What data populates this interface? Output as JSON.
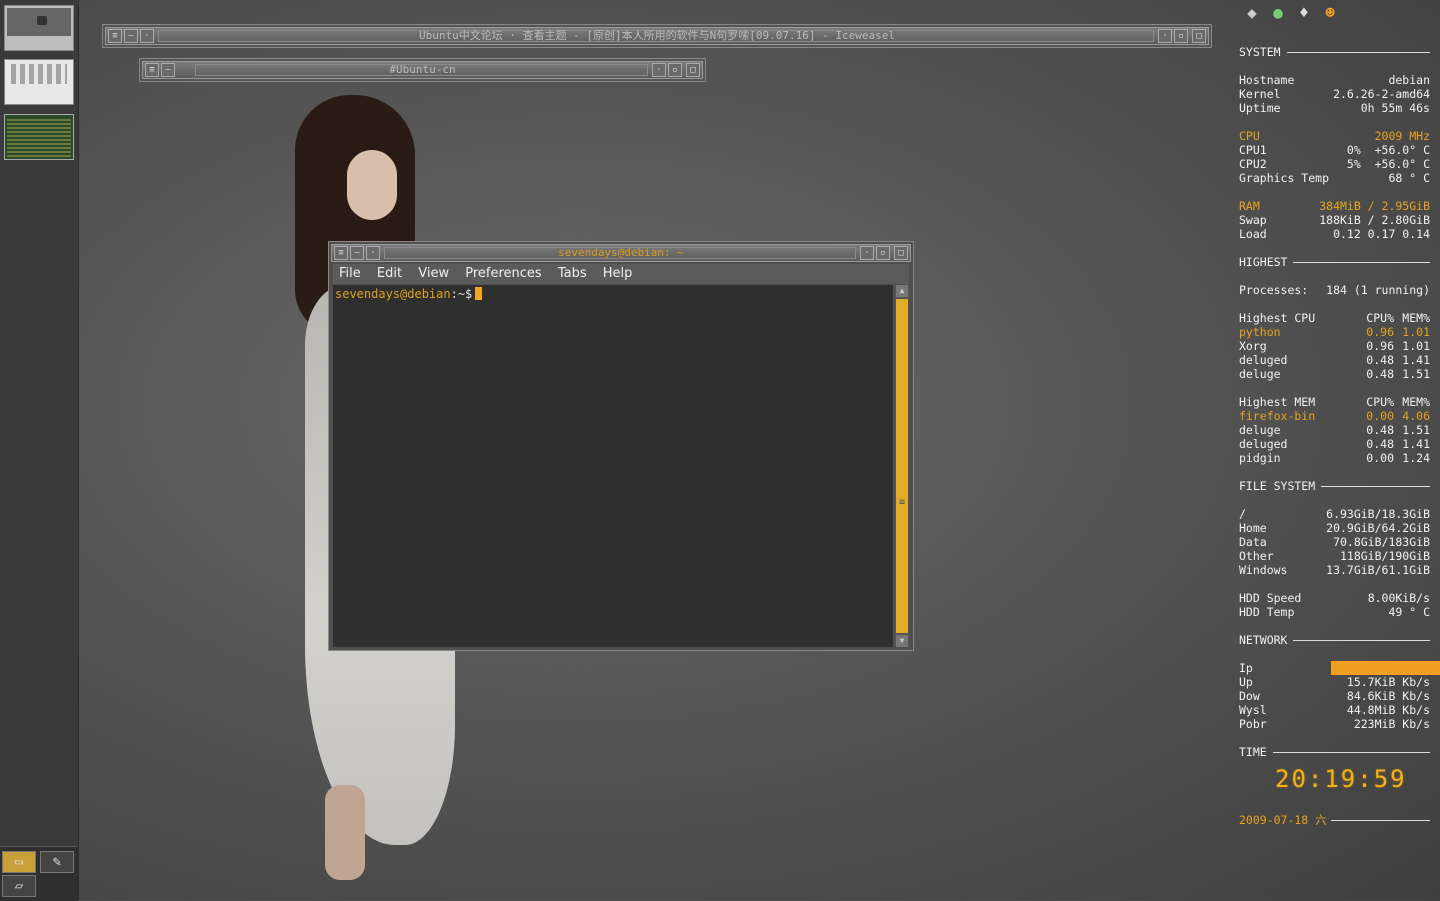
{
  "windows": {
    "iceweasel": {
      "title": "Ubuntu中文论坛 · 查看主题 - [原创]本人所用的软件与N句罗嗦[09.07.16] - Iceweasel"
    },
    "irc": {
      "title": "#Ubuntu-cn"
    },
    "terminal": {
      "title": "sevendays@debian: ~",
      "menu": [
        "File",
        "Edit",
        "View",
        "Preferences",
        "Tabs",
        "Help"
      ],
      "prompt_user": "sevendays@debian",
      "prompt_rest": ":~$"
    }
  },
  "conky": {
    "system": {
      "header": "SYSTEM",
      "rows": [
        {
          "label": "Hostname",
          "value": "debian"
        },
        {
          "label": "Kernel",
          "value": "2.6.26-2-amd64"
        },
        {
          "label": "Uptime",
          "value": "0h 55m 46s"
        }
      ],
      "cpu": {
        "label": "CPU",
        "value": "2009 MHz"
      },
      "cpu_rows": [
        {
          "label": "CPU1",
          "pct": "0%",
          "temp": "+56.0° C"
        },
        {
          "label": "CPU2",
          "pct": "5%",
          "temp": "+56.0° C"
        }
      ],
      "gfx": {
        "label": "Graphics Temp",
        "value": "68 ° C"
      },
      "ram": {
        "label": "RAM",
        "value": "384MiB / 2.95GiB"
      },
      "swap": {
        "label": "Swap",
        "value": "188KiB / 2.80GiB"
      },
      "load": {
        "label": "Load",
        "value": "0.12 0.17 0.14"
      }
    },
    "highest": {
      "header": "HIGHEST",
      "processes_label": "Processes:",
      "processes_value": "184 (1 running)",
      "cpu_title": "Highest CPU",
      "col_cpu": "CPU%",
      "col_mem": "MEM%",
      "cpu_rows": [
        {
          "name": "python",
          "cpu": "0.96",
          "mem": "1.01"
        },
        {
          "name": "Xorg",
          "cpu": "0.96",
          "mem": "1.01"
        },
        {
          "name": "deluged",
          "cpu": "0.48",
          "mem": "1.41"
        },
        {
          "name": "deluge",
          "cpu": "0.48",
          "mem": "1.51"
        }
      ],
      "mem_title": "Highest MEM",
      "mem_rows": [
        {
          "name": "firefox-bin",
          "cpu": "0.00",
          "mem": "4.06"
        },
        {
          "name": "deluge",
          "cpu": "0.48",
          "mem": "1.51"
        },
        {
          "name": "deluged",
          "cpu": "0.48",
          "mem": "1.41"
        },
        {
          "name": "pidgin",
          "cpu": "0.00",
          "mem": "1.24"
        }
      ]
    },
    "filesystem": {
      "header": "FILE SYSTEM",
      "rows": [
        {
          "label": "/",
          "value": "6.93GiB/18.3GiB"
        },
        {
          "label": "Home",
          "value": "20.9GiB/64.2GiB"
        },
        {
          "label": "Data",
          "value": "70.8GiB/183GiB"
        },
        {
          "label": "Other",
          "value": "118GiB/190GiB"
        },
        {
          "label": "Windows",
          "value": "13.7GiB/61.1GiB"
        }
      ],
      "hdd_speed": {
        "label": "HDD Speed",
        "value": "8.00KiB/s"
      },
      "hdd_temp": {
        "label": "HDD Temp",
        "value": "49 ° C"
      }
    },
    "network": {
      "header": "NETWORK",
      "ip_label": "Ip",
      "rows": [
        {
          "label": "Up",
          "value": "15.7KiB Kb/s"
        },
        {
          "label": "Dow",
          "value": "84.6KiB Kb/s"
        },
        {
          "label": "Wysl",
          "value": "44.8MiB Kb/s"
        },
        {
          "label": "Pobr",
          "value": "223MiB Kb/s"
        }
      ]
    },
    "time": {
      "header": "TIME",
      "clock": "20:19:59",
      "date": "2009-07-18 六"
    }
  },
  "colors": {
    "accent": "#e8a41c",
    "background": "#555555"
  }
}
